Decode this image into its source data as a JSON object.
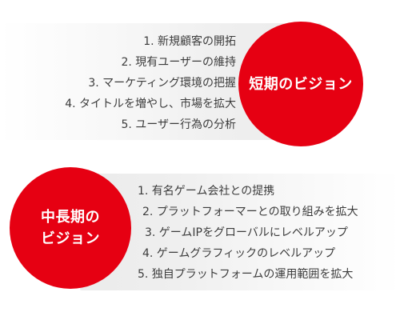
{
  "short_term": {
    "title": "短期のビジョン",
    "items": [
      "1. 新規顧客の開拓",
      "2. 現有ユーザーの維持",
      "3. マーケティング環境の把握",
      "4. タイトルを増やし、市場を拡大",
      "5. ユーザー行為の分析"
    ]
  },
  "mid_long_term": {
    "title_line1": "中長期の",
    "title_line2": "ビジョン",
    "items": [
      "1. 有名ゲーム会社との提携",
      "2. プラットフォーマーとの取り組みを拡大",
      "3. ゲームIPをグローバルにレベルアップ",
      "4. ゲームグラフィックのレベルアップ",
      "5. 独自プラットフォームの運用範囲を拡大"
    ]
  },
  "colors": {
    "accent": "#e60012",
    "text": "#3c3c3c",
    "panel": "#efefef"
  }
}
